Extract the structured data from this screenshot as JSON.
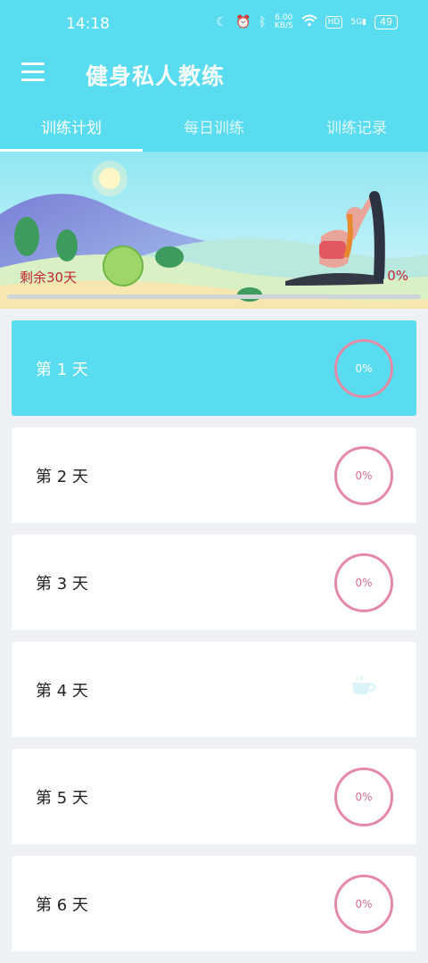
{
  "status_bar": {
    "time": "14:18",
    "net_speed": "6.00",
    "net_unit": "KB/S",
    "hd": "HD",
    "signal": "5G",
    "battery": "49"
  },
  "app_bar": {
    "title": "健身私人教练"
  },
  "tabs": [
    {
      "label": "训练计划",
      "active": true
    },
    {
      "label": "每日训练",
      "active": false
    },
    {
      "label": "训练记录",
      "active": false
    }
  ],
  "banner": {
    "remaining_text": "剩余30天",
    "progress_text": "0%",
    "progress_value": 0
  },
  "days": [
    {
      "label": "第 1 天",
      "progress": "0%",
      "selected": true
    },
    {
      "label": "第 2 天",
      "progress": "0%"
    },
    {
      "label": "第 3 天",
      "progress": "0%"
    },
    {
      "label": "第 4 天",
      "rest_icon": "coffee-cup-icon"
    },
    {
      "label": "第 5 天",
      "progress": "0%"
    },
    {
      "label": "第 6 天",
      "progress": "0%"
    }
  ],
  "colors": {
    "accent": "#5adcf0",
    "ring": "#e58aa6",
    "warning_text": "#c1272d"
  }
}
